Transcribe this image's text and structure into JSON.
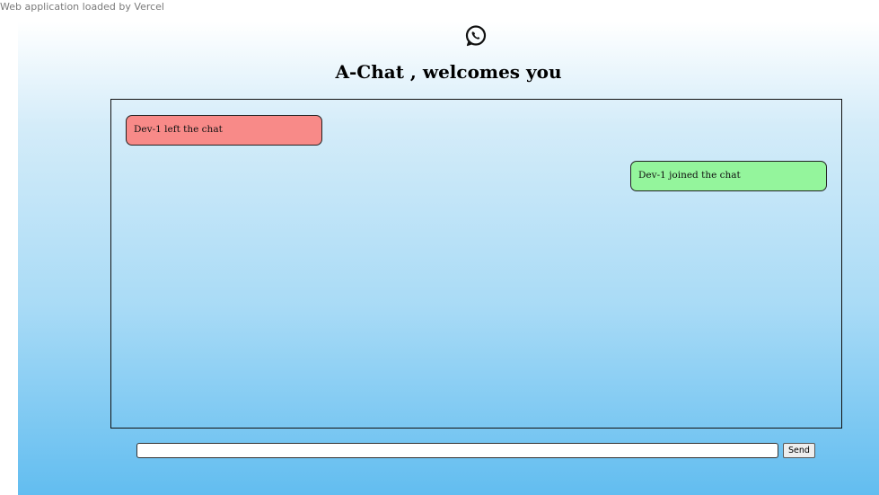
{
  "topbar": {
    "text": "Web application loaded by Vercel"
  },
  "header": {
    "logo_icon": "whatsapp-icon",
    "title": "A-Chat , welcomes you"
  },
  "messages": [
    {
      "text": "Dev-1 left the chat",
      "side": "left",
      "color": "#f88a88"
    },
    {
      "text": "Dev-1 joined the chat",
      "side": "right",
      "color": "#94f59c"
    }
  ],
  "composer": {
    "input_value": "",
    "input_placeholder": "",
    "send_label": "Send"
  },
  "colors": {
    "gradient_top": "#ffffff",
    "gradient_bottom": "#62bdf0",
    "left_message": "#f88a88",
    "right_message": "#94f59c"
  }
}
